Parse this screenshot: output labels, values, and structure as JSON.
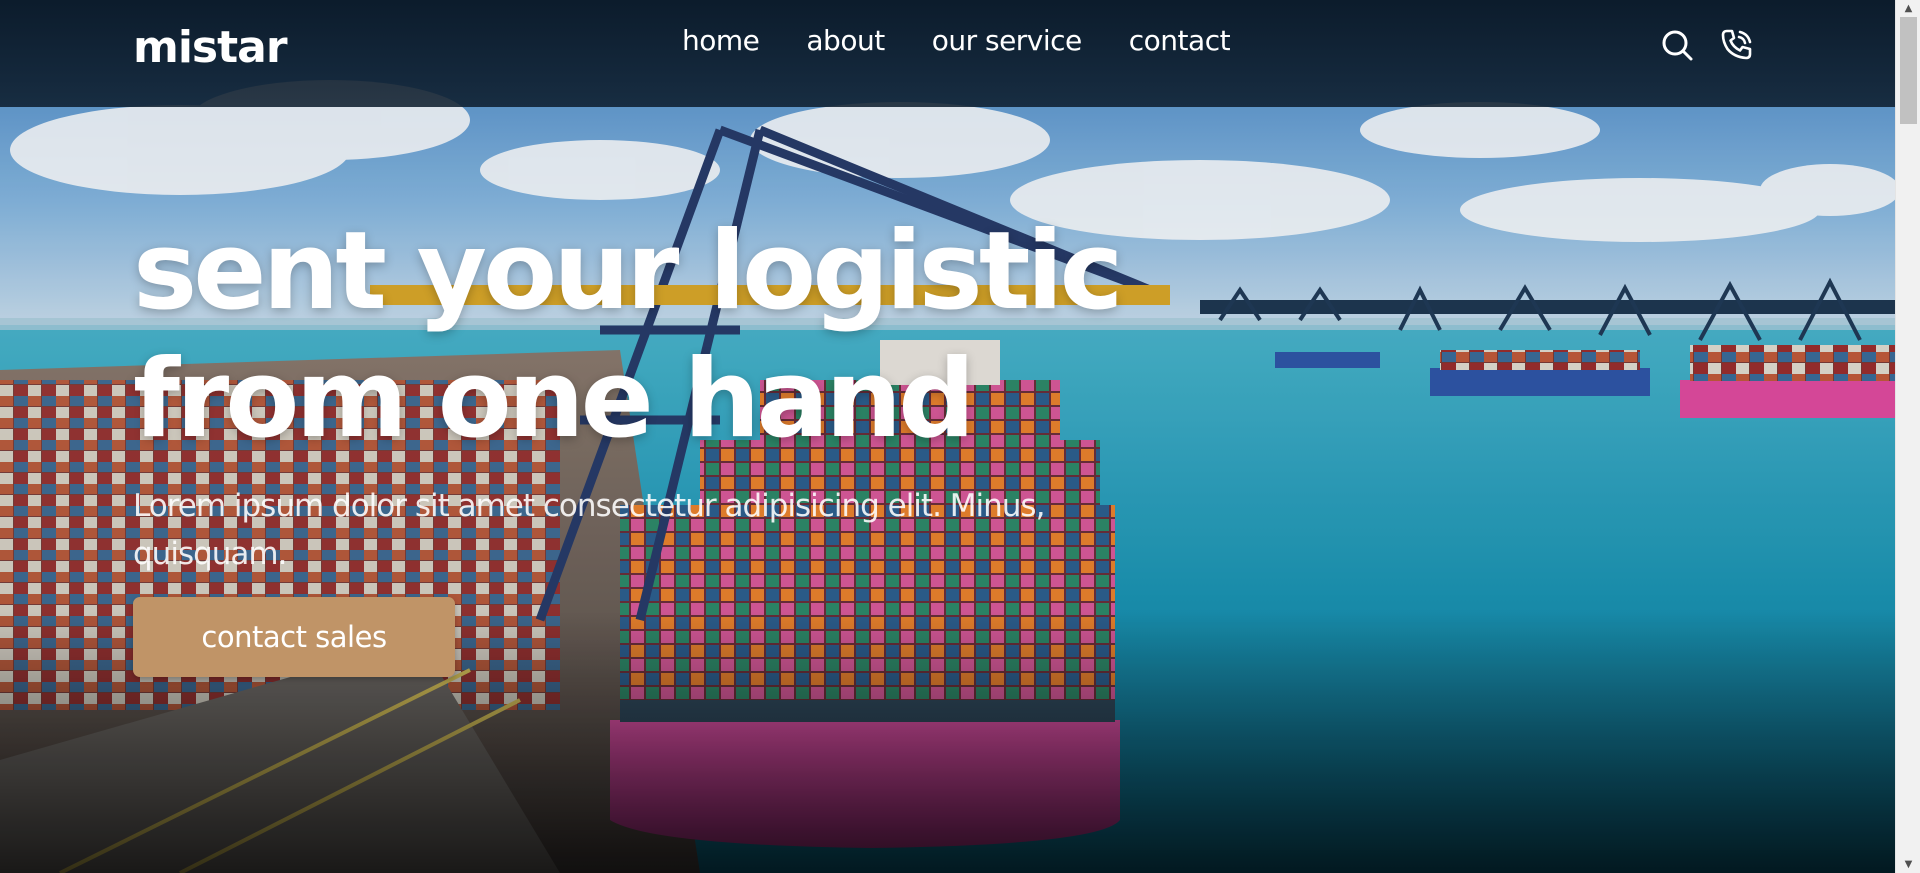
{
  "navbar": {
    "brand": "mistar",
    "links": [
      {
        "label": "home"
      },
      {
        "label": "about"
      },
      {
        "label": "our service"
      },
      {
        "label": "contact"
      }
    ],
    "icons": [
      "search-icon",
      "phone-icon"
    ]
  },
  "hero": {
    "title_line1": "sent your logistic",
    "title_line2": "from one hand",
    "subtitle": "Lorem ipsum dolor sit amet consectetur adipisicing elit. Minus, quisquam.",
    "cta_label": "contact sales",
    "background": "aerial view of container port with cargo ship and cranes"
  },
  "colors": {
    "accent": "#c09467",
    "navbar_bg": "#0c1c2c",
    "text": "#ffffff"
  }
}
